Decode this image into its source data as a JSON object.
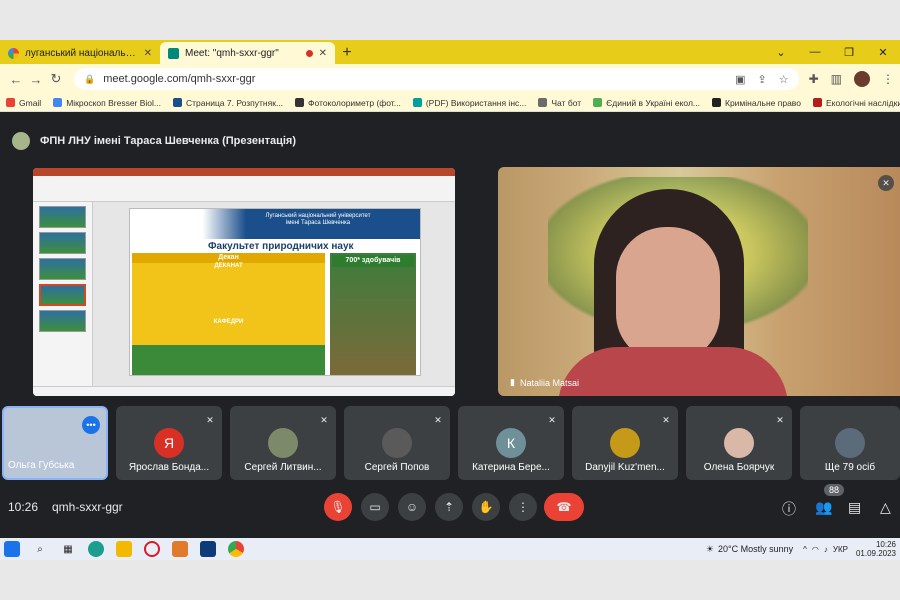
{
  "browser": {
    "tabs": [
      {
        "title": "луганський національний університет",
        "close": "✕"
      },
      {
        "title": "Meet: \"qmh-sxxr-ggr\"",
        "close": "✕"
      }
    ],
    "new_tab": "+",
    "window_controls": [
      "⌄",
      "—",
      "❐",
      "✕"
    ],
    "url": "meet.google.com/qmh-sxxr-ggr",
    "bookmarks": [
      {
        "label": "Gmail",
        "color": "#ea4335"
      },
      {
        "label": "Мікроскоп Bresser Biol...",
        "color": "#4285f4"
      },
      {
        "label": "Страница 7. Розпутняк...",
        "color": "#1a4f8b"
      },
      {
        "label": "Фотоколориметр (фот...",
        "color": "#333333"
      },
      {
        "label": "(PDF) Використання інс...",
        "color": "#00a0a0"
      },
      {
        "label": "Чат бот",
        "color": "#6b6b6b"
      },
      {
        "label": "Єдиний в Україні екол...",
        "color": "#4caf50"
      },
      {
        "label": "Кримінальне право",
        "color": "#222222"
      },
      {
        "label": "Екологічні наслідки вій...",
        "color": "#b71c1c"
      }
    ]
  },
  "meet": {
    "presentation_title": "ФПН ЛНУ імені Тараса Шевченка (Презентація)",
    "slide": {
      "university": "Луганський національний університет імені Тараса Шевченка",
      "faculty": "Факультет природничих наук",
      "dean": "Декан",
      "deanate": "ДЕКАНАТ",
      "departments": "КАФЕДРИ",
      "badge": "700* здобувачів"
    },
    "speaker_name": "Nataliia Matsai",
    "participants": [
      {
        "name": "Ольга Губська",
        "initial": "",
        "color": "#b8c6d8"
      },
      {
        "name": "Ярослав Бонда...",
        "initial": "Я",
        "color": "#d93025"
      },
      {
        "name": "Сергей Литвин...",
        "initial": "",
        "color": "#7c8a6a"
      },
      {
        "name": "Сергей Попов",
        "initial": "",
        "color": "#5a5a5a"
      },
      {
        "name": "Катерина Бере...",
        "initial": "К",
        "color": "#6f8f99"
      },
      {
        "name": "Danyjil Kuz'men...",
        "initial": "",
        "color": "#c49a18"
      },
      {
        "name": "Олена Боярчук",
        "initial": "",
        "color": "#d9b8a8"
      },
      {
        "name": "Ще 79 осіб",
        "initial": "",
        "color": "#5b6b7a"
      }
    ],
    "time": "10:26",
    "meeting_code": "qmh-sxxr-ggr",
    "participant_count": "88"
  },
  "taskbar": {
    "weather": "20°C  Mostly sunny",
    "lang": "УКР",
    "time": "10:26",
    "date": "01.09.2023"
  }
}
